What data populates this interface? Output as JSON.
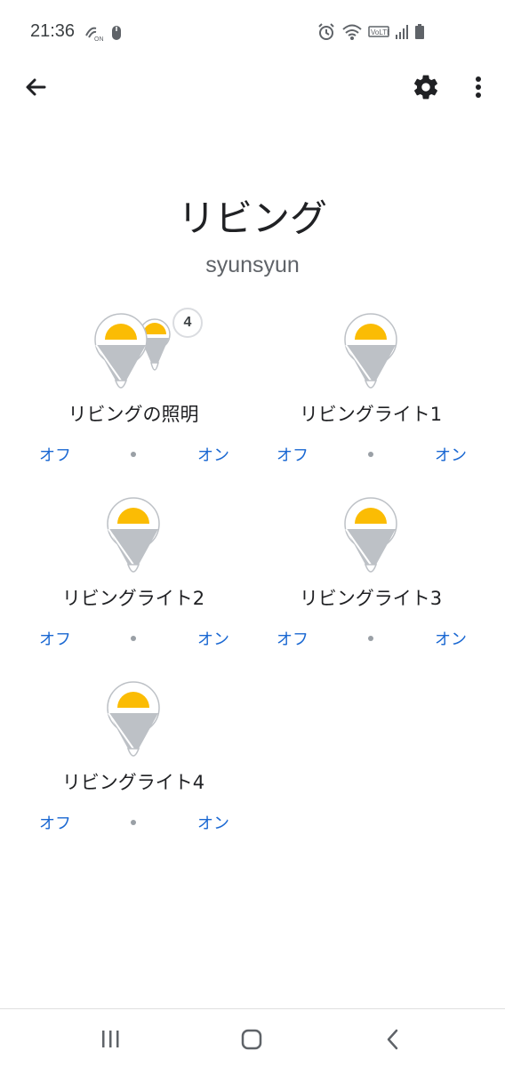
{
  "status_bar": {
    "time": "21:36",
    "left_icons": [
      "nfc-on-icon",
      "mouse-icon"
    ],
    "right_icons": [
      "alarm-icon",
      "wifi-icon",
      "volte-icon",
      "signal-icon",
      "battery-icon"
    ]
  },
  "app_bar": {
    "back_icon": "arrow-back-icon",
    "settings_icon": "gear-icon",
    "more_icon": "more-vert-icon"
  },
  "room": {
    "title": "リビング",
    "home": "syunsyun"
  },
  "devices": [
    {
      "name": "リビングの照明",
      "off_label": "オフ",
      "on_label": "オン",
      "group_count": "4",
      "icon": "light-group-icon"
    },
    {
      "name": "リビングライト1",
      "off_label": "オフ",
      "on_label": "オン",
      "icon": "light-bulb-icon"
    },
    {
      "name": "リビングライト2",
      "off_label": "オフ",
      "on_label": "オン",
      "icon": "light-bulb-icon"
    },
    {
      "name": "リビングライト3",
      "off_label": "オフ",
      "on_label": "オン",
      "icon": "light-bulb-icon"
    },
    {
      "name": "リビングライト4",
      "off_label": "オフ",
      "on_label": "オン",
      "icon": "light-bulb-icon"
    }
  ],
  "colors": {
    "accent": "#1967d2",
    "bulb_on": "#fbbc04",
    "bulb_body": "#bdc1c6"
  },
  "nav_bar": {
    "icons": [
      "recent-apps-icon",
      "home-icon",
      "back-nav-icon"
    ]
  }
}
